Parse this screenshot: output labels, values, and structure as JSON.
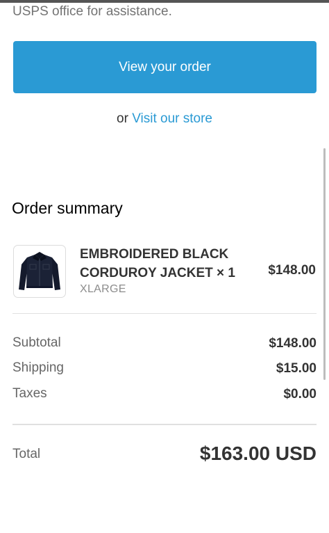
{
  "intro": {
    "text": "USPS office for assistance."
  },
  "actions": {
    "view_order_label": "View your order",
    "or_text": "or ",
    "store_link_label": "Visit our store"
  },
  "order_summary": {
    "heading": "Order summary",
    "product": {
      "name": "EMBROIDERED BLACK CORDUROY JACKET × 1",
      "variant": "XLARGE",
      "price": "$148.00",
      "thumbnail_icon": "jacket-icon"
    },
    "costs": [
      {
        "label": "Subtotal",
        "value": "$148.00"
      },
      {
        "label": "Shipping",
        "value": "$15.00"
      },
      {
        "label": "Taxes",
        "value": "$0.00"
      }
    ],
    "total": {
      "label": "Total",
      "value": "$163.00 USD"
    }
  },
  "colors": {
    "accent": "#2a9ad4",
    "text": "#333333",
    "muted": "#8c8c8c"
  }
}
